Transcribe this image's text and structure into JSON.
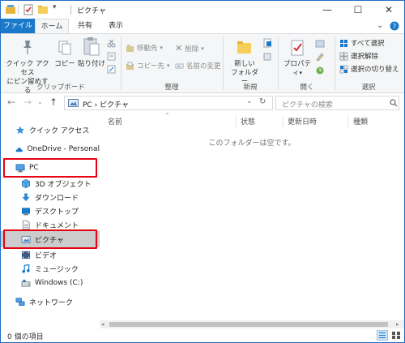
{
  "window": {
    "title": "ピクチャ",
    "minimize_glyph": "—",
    "maximize_glyph": "☐",
    "close_glyph": "✕"
  },
  "ribbon_tabs": {
    "file": "ファイル",
    "home": "ホーム",
    "share": "共有",
    "view": "表示"
  },
  "ribbon": {
    "pin_quick_access": [
      "クイック アクセス",
      "にピン留めする"
    ],
    "copy": "コピー",
    "paste": "貼り付け",
    "clipboard_group": "クリップボード",
    "move_to": "移動先",
    "copy_to": "コピー先",
    "delete": "削除",
    "rename": "名前の変更",
    "organize_group": "整理",
    "new_folder": [
      "新しい",
      "フォルダー"
    ],
    "new_group": "新規",
    "properties": "プロパティ",
    "open_group": "開く",
    "select_all": "すべて選択",
    "select_none": "選択解除",
    "invert_selection": "選択の切り替え",
    "select_group": "選択"
  },
  "address": {
    "breadcrumb": "PC  ›  ピクチャ",
    "search_placeholder": "ピクチャの検索"
  },
  "nav": {
    "items": [
      {
        "label": "クイック アクセス",
        "icon": "star-icon"
      },
      {
        "label": "OneDrive - Personal",
        "icon": "cloud-icon"
      },
      {
        "label": "PC",
        "icon": "computer-icon"
      },
      {
        "label": "3D オブジェクト",
        "icon": "cube-icon"
      },
      {
        "label": "ダウンロード",
        "icon": "download-icon"
      },
      {
        "label": "デスクトップ",
        "icon": "desktop-icon"
      },
      {
        "label": "ドキュメント",
        "icon": "document-icon"
      },
      {
        "label": "ピクチャ",
        "icon": "pictures-icon"
      },
      {
        "label": "ビデオ",
        "icon": "video-icon"
      },
      {
        "label": "ミュージック",
        "icon": "music-icon"
      },
      {
        "label": "Windows (C:)",
        "icon": "drive-icon"
      },
      {
        "label": "ネットワーク",
        "icon": "network-icon"
      }
    ]
  },
  "content": {
    "columns": [
      "名前",
      "状態",
      "更新日時",
      "種類"
    ],
    "empty_message": "このフォルダーは空です。"
  },
  "status": {
    "item_count": "0 個の項目"
  },
  "colors": {
    "accent": "#1979ca",
    "highlight_box": "#e60012",
    "selected_bg": "#cccccc"
  }
}
